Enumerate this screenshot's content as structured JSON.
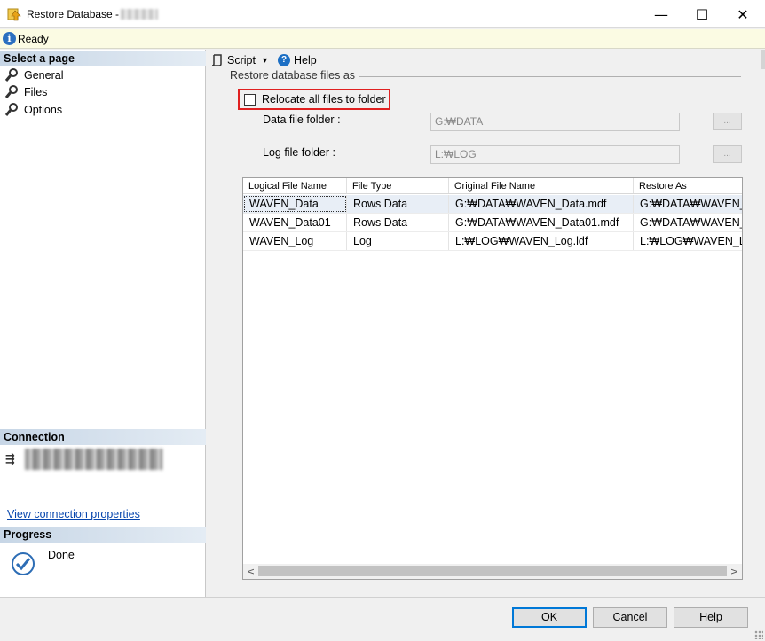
{
  "window": {
    "title": "Restore Database -",
    "minimize_glyph": "—",
    "maximize_glyph": "☐",
    "close_glyph": "✕"
  },
  "status": {
    "icon_letter": "i",
    "text": "Ready"
  },
  "left_panel": {
    "select_page_header": "Select a page",
    "pages": [
      {
        "label": "General",
        "icon": "wrench-icon"
      },
      {
        "label": "Files",
        "icon": "wrench-icon"
      },
      {
        "label": "Options",
        "icon": "wrench-icon"
      }
    ],
    "connection_header": "Connection",
    "view_connection_link": "View connection properties",
    "progress_header": "Progress",
    "progress_status": "Done"
  },
  "toolbar": {
    "script_label": "Script",
    "script_dropdown": "▾",
    "help_label": "Help"
  },
  "files": {
    "group_label": "Restore database files as",
    "relocate_label": "Relocate all files to folder",
    "relocate_checked": false,
    "data_folder_label": "Data file folder :",
    "data_folder_value": "G:₩DATA",
    "log_folder_label": "Log file folder :",
    "log_folder_value": "L:₩LOG",
    "browse_label": "..."
  },
  "grid": {
    "columns": [
      "Logical File Name",
      "File Type",
      "Original File Name",
      "Restore As"
    ],
    "rows": [
      [
        "WAVEN_Data",
        "Rows Data",
        "G:₩DATA₩WAVEN_Data.mdf",
        "G:₩DATA₩WAVEN_"
      ],
      [
        "WAVEN_Data01",
        "Rows Data",
        "G:₩DATA₩WAVEN_Data01.mdf",
        "G:₩DATA₩WAVEN_"
      ],
      [
        "WAVEN_Log",
        "Log",
        "L:₩LOG₩WAVEN_Log.ldf",
        "L:₩LOG₩WAVEN_L"
      ]
    ],
    "scroll_left": "<",
    "scroll_right": ">"
  },
  "buttons": {
    "ok": "OK",
    "cancel": "Cancel",
    "help": "Help"
  },
  "colors": {
    "highlight_border": "#e02020",
    "ok_focus": "#0078d7",
    "link": "#0645ad"
  }
}
